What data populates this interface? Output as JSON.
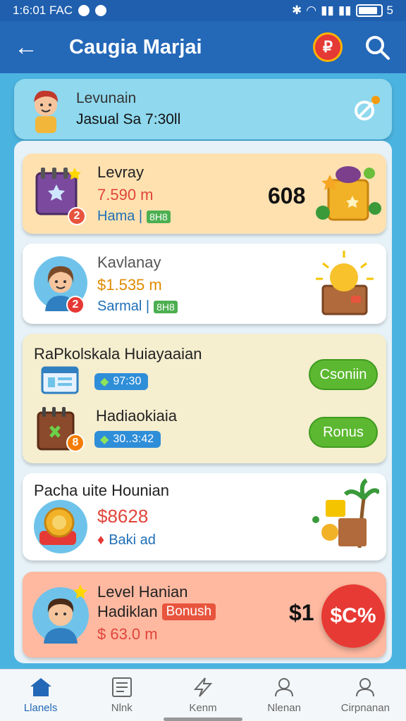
{
  "status_bar": {
    "time": "1:6:01 FAC",
    "battery_label": "5"
  },
  "app_bar": {
    "title": "Caugia Marjai",
    "back_icon": "arrow-left-icon",
    "notification_badge": "₽",
    "search_icon": "search-icon"
  },
  "user": {
    "name": "Levunain",
    "subtitle": "Jasual Sa 7:30ll"
  },
  "cards": [
    {
      "title": "Levray",
      "amount": "7.590 m",
      "sub": "Hama |",
      "tag": "8H8",
      "badge": "2",
      "big_value": "608"
    },
    {
      "title": "Kavlanay",
      "amount": "$1.535 m",
      "sub": "Sarmal |",
      "tag": "8H8",
      "badge": "2"
    }
  ],
  "rewards": {
    "title": "RaPkolskala Huiayaaian",
    "row1": {
      "pill": "97:30",
      "button": "Csoniin"
    },
    "row2": {
      "title": "Hadiaokiaia",
      "pill": "30..3:42",
      "button": "Ronus",
      "badge": "8"
    }
  },
  "card4": {
    "title": "Pacha uite Hounian",
    "amount": "$8628",
    "sub": "Baki ad"
  },
  "card5": {
    "title": "Level Hanian",
    "sub": "Hadiklan",
    "bonus": "Bonush",
    "amount": "$ 63.0 m",
    "big_value": "$1"
  },
  "fab_label": "$C%",
  "bottom_nav": [
    {
      "label": "Llanels",
      "icon": "home-icon",
      "active": true
    },
    {
      "label": "Nlnk",
      "icon": "document-icon",
      "active": false
    },
    {
      "label": "Kenm",
      "icon": "lightning-icon",
      "active": false
    },
    {
      "label": "Nlenan",
      "icon": "person-icon",
      "active": false
    },
    {
      "label": "Cirpnanan",
      "icon": "profile-icon",
      "active": false
    }
  ],
  "colors": {
    "app_bar": "#2468b8",
    "background": "#4bb3df",
    "accent_green": "#5cb830",
    "accent_red": "#e83a34",
    "amount_orange": "#e08a00",
    "amount_red": "#e0453a"
  }
}
